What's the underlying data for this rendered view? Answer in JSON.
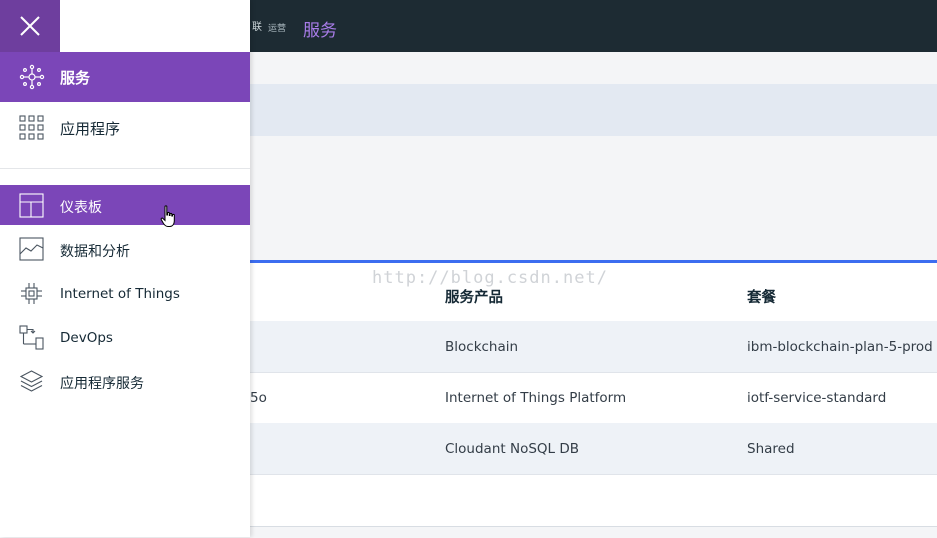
{
  "topbar": {
    "brand_fragment": "联",
    "brand_sub": "运营",
    "page_title": "服务"
  },
  "table": {
    "headers": [
      "服务产品",
      "套餐"
    ],
    "rows": [
      {
        "id_fragment": "",
        "offering": "Blockchain",
        "plan": "ibm-blockchain-plan-5-prod"
      },
      {
        "id_fragment": "5o",
        "offering": "Internet of Things Platform",
        "plan": "iotf-service-standard"
      },
      {
        "id_fragment": "",
        "offering": "Cloudant NoSQL DB",
        "plan": "Shared"
      }
    ]
  },
  "watermark": "http://blog.csdn.net/",
  "sidemenu": {
    "close_icon": "close-icon",
    "items": [
      {
        "label": "服务",
        "icon": "services-icon",
        "state": "active"
      },
      {
        "label": "应用程序",
        "icon": "apps-grid-icon",
        "state": "normal"
      },
      {
        "label": "仪表板",
        "icon": "dashboard-icon",
        "state": "hover"
      },
      {
        "label": "数据和分析",
        "icon": "analytics-icon",
        "state": "normal"
      },
      {
        "label": "Internet of Things",
        "icon": "chip-icon",
        "state": "normal"
      },
      {
        "label": "DevOps",
        "icon": "devops-icon",
        "state": "normal"
      },
      {
        "label": "应用程序服务",
        "icon": "layers-icon",
        "state": "normal"
      }
    ]
  },
  "colors": {
    "menu_purple": "#7b46b8",
    "close_purple": "#6e3e9e",
    "topbar": "#1d2b33",
    "title_accent": "#a87ce8",
    "table_accent": "#3c6df0"
  }
}
